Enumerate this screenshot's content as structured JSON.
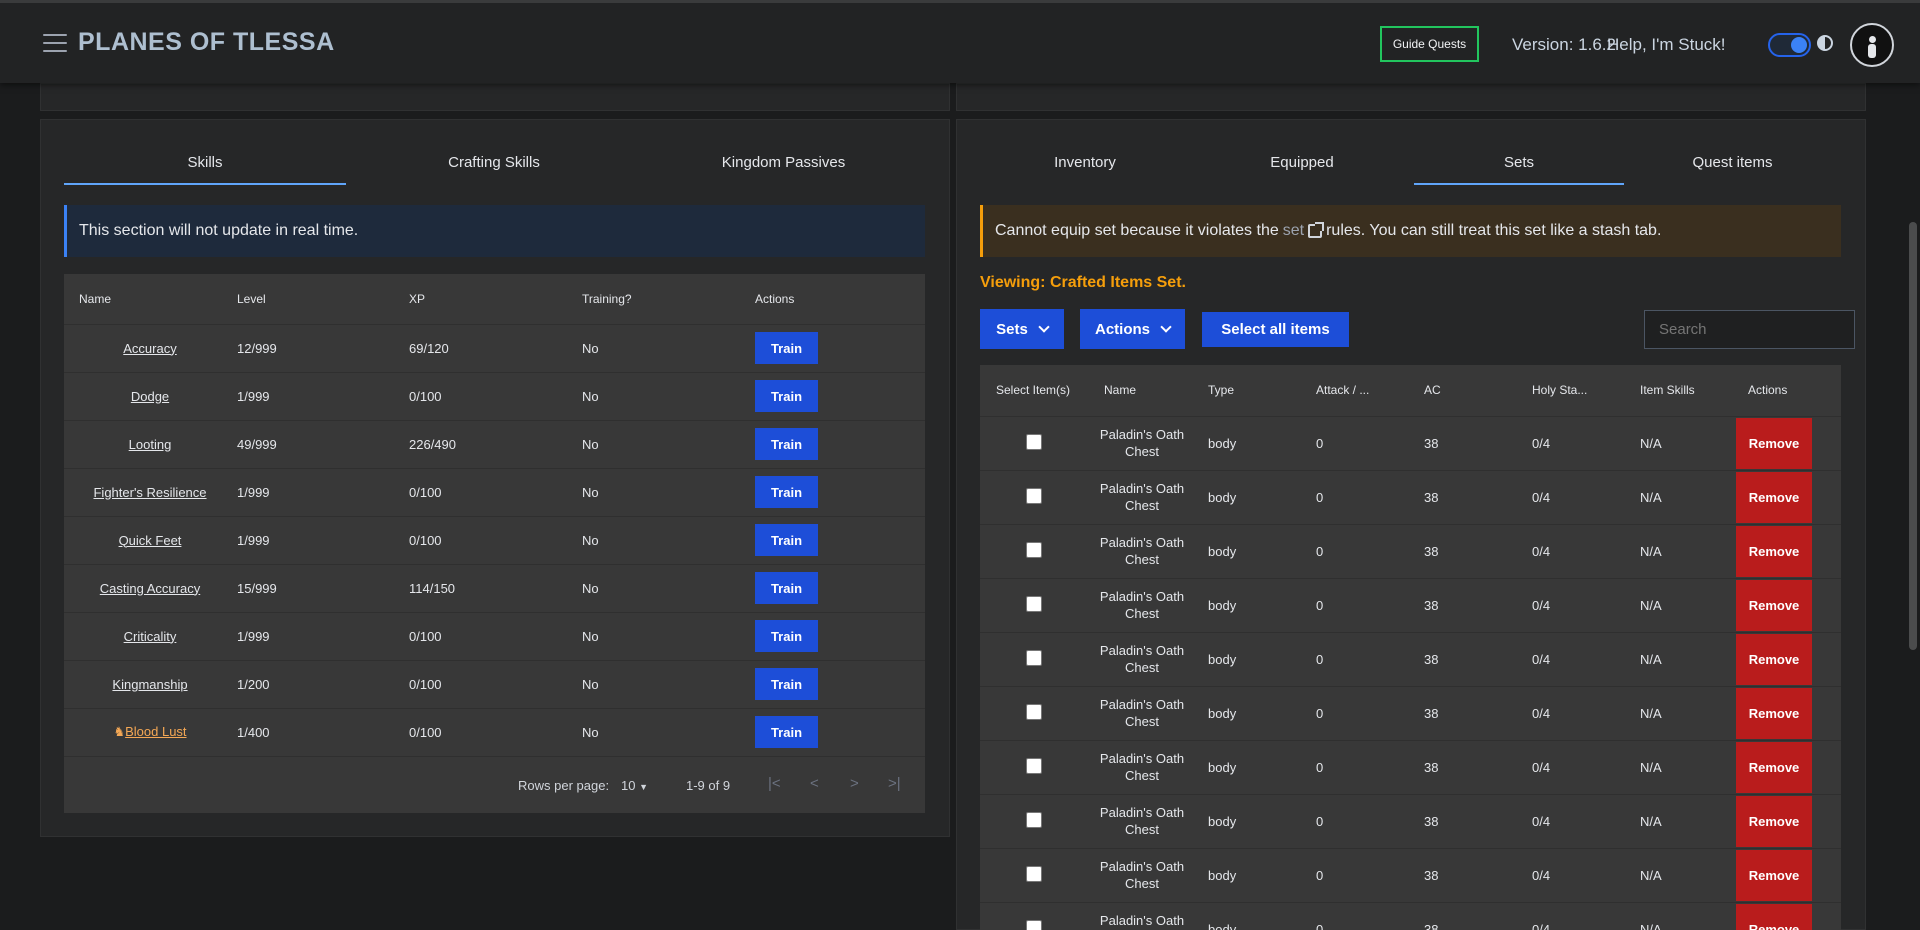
{
  "header": {
    "brand": "PLANES OF TLESSA",
    "guide_quests": "Guide Quests",
    "version": "Version: 1.6.2",
    "help": "Help, I'm Stuck!"
  },
  "skills_panel": {
    "tabs": [
      "Skills",
      "Crafting Skills",
      "Kingdom Passives"
    ],
    "info": "This section will not update in real time.",
    "columns": [
      "Name",
      "Level",
      "XP",
      "Training?",
      "Actions"
    ],
    "rows": [
      {
        "name": "Accuracy",
        "level": "12/999",
        "xp": "69/120",
        "training": "No",
        "action": "Train"
      },
      {
        "name": "Dodge",
        "level": "1/999",
        "xp": "0/100",
        "training": "No",
        "action": "Train"
      },
      {
        "name": "Looting",
        "level": "49/999",
        "xp": "226/490",
        "training": "No",
        "action": "Train"
      },
      {
        "name": "Fighter's Resilience",
        "level": "1/999",
        "xp": "0/100",
        "training": "No",
        "action": "Train"
      },
      {
        "name": "Quick Feet",
        "level": "1/999",
        "xp": "0/100",
        "training": "No",
        "action": "Train"
      },
      {
        "name": "Casting Accuracy",
        "level": "15/999",
        "xp": "114/150",
        "training": "No",
        "action": "Train"
      },
      {
        "name": "Criticality",
        "level": "1/999",
        "xp": "0/100",
        "training": "No",
        "action": "Train"
      },
      {
        "name": "Kingmanship",
        "level": "1/200",
        "xp": "0/100",
        "training": "No",
        "action": "Train"
      },
      {
        "name": "Blood Lust",
        "level": "1/400",
        "xp": "0/100",
        "training": "No",
        "action": "Train",
        "highlight": true
      }
    ],
    "pager": {
      "rows_label": "Rows per page:",
      "rows_value": "10",
      "range": "1-9 of 9"
    }
  },
  "inventory_panel": {
    "tabs": [
      "Inventory",
      "Equipped",
      "Sets",
      "Quest items"
    ],
    "warning_pre": "Cannot equip set because it violates the",
    "warning_link": "set",
    "warning_post": "rules. You can still treat this set like a stash tab.",
    "viewing": "Viewing: Crafted Items Set.",
    "sets_btn": "Sets",
    "actions_btn": "Actions",
    "select_all_btn": "Select all items",
    "search_placeholder": "Search",
    "columns": [
      "Select Item(s)",
      "Name",
      "Type",
      "Attack / ...",
      "AC",
      "Holy Sta...",
      "Item Skills",
      "Actions"
    ],
    "row_template": {
      "name": "Paladin's Oath Chest",
      "type": "body",
      "attack": "0",
      "ac": "38",
      "holy": "0/4",
      "skills": "N/A",
      "action": "Remove"
    },
    "row_count": 10
  },
  "colors": {
    "accent_blue": "#1d4ed8",
    "danger_red": "#b91c1c",
    "warning_orange": "#f59e0b",
    "guide_green": "#22c55e"
  }
}
